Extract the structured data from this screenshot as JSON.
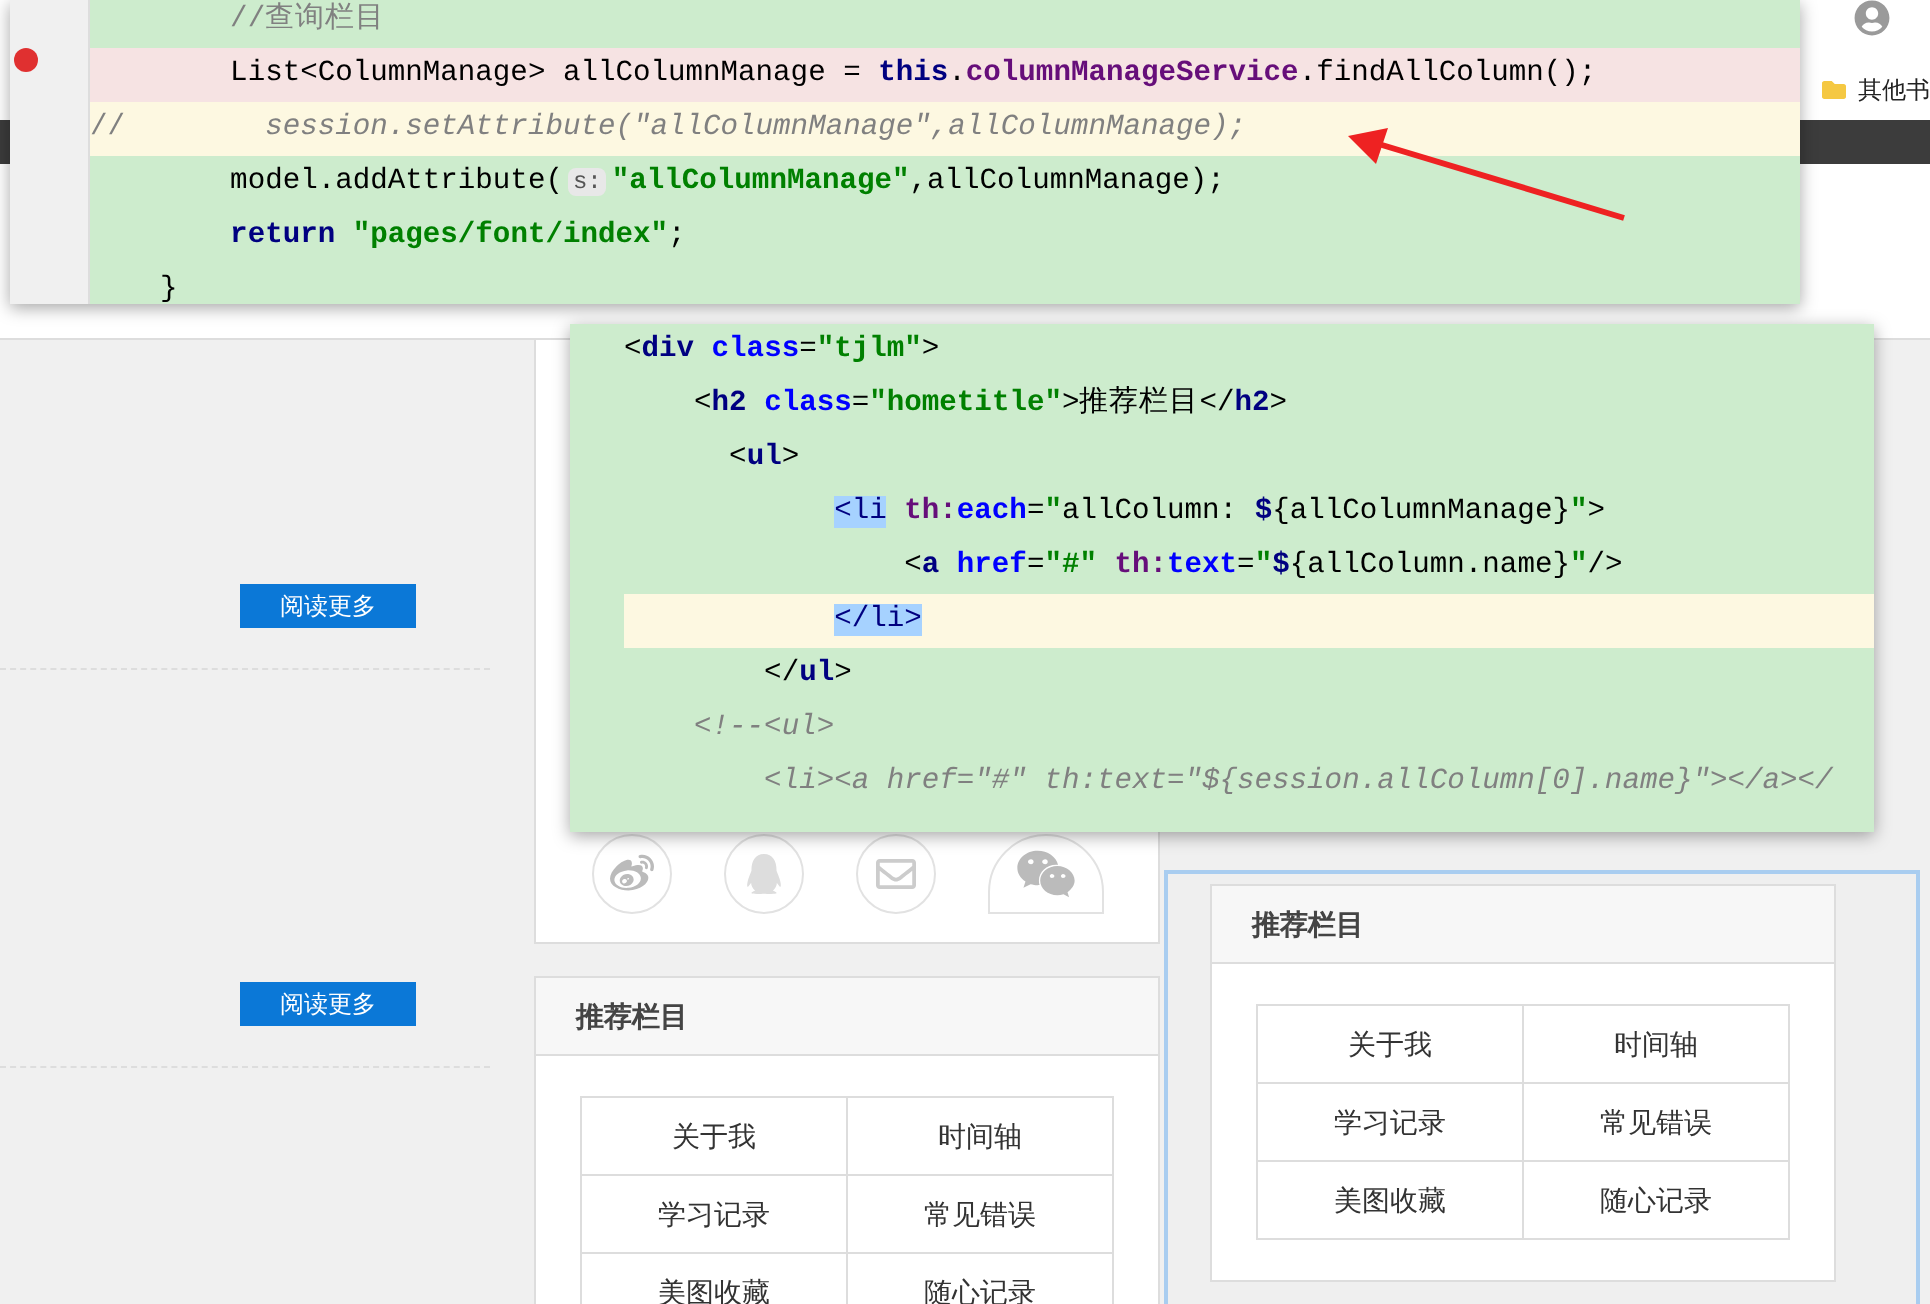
{
  "browser": {
    "bookmark": "其他书"
  },
  "page": {
    "read_more_buttons": [
      "阅读更多",
      "阅读更多"
    ],
    "recommend_card": {
      "title": "推荐栏目",
      "links": [
        "关于我",
        "时间轴",
        "学习记录",
        "常见错误",
        "美图收藏",
        "随心记录"
      ]
    }
  },
  "popup": {
    "title": "推荐栏目",
    "links": [
      "关于我",
      "时间轴",
      "学习记录",
      "常见错误",
      "美图收藏",
      "随心记录"
    ]
  },
  "editor_top": {
    "lines": [
      {
        "kind": "added",
        "segments": [
          {
            "kind": "comment",
            "text": "        //查询栏目"
          }
        ]
      },
      {
        "kind": "deleted",
        "segments": [
          {
            "kind": "plain",
            "text": "        List<ColumnManage> allColumnManage = "
          },
          {
            "kind": "keyword",
            "text": "this"
          },
          {
            "kind": "plain",
            "text": "."
          },
          {
            "kind": "field",
            "text": "columnManageService"
          },
          {
            "kind": "plain",
            "text": ".findAllColumn();"
          }
        ]
      },
      {
        "kind": "commented",
        "segments": [
          {
            "kind": "comment",
            "text": "//"
          },
          {
            "kind": "comment_italic",
            "text": "        session.setAttribute(\"allColumnManage\",allColumnManage);"
          }
        ]
      },
      {
        "kind": "added",
        "segments": [
          {
            "kind": "plain",
            "text": "        model.addAttribute("
          },
          {
            "kind": "hint",
            "text": "s:"
          },
          {
            "kind": "string",
            "text": "\"allColumnManage\""
          },
          {
            "kind": "plain",
            "text": ",allColumnManage);"
          }
        ]
      },
      {
        "kind": "added",
        "segments": [
          {
            "kind": "keyword",
            "text": "        return "
          },
          {
            "kind": "string",
            "text": "\"pages/font/index\""
          },
          {
            "kind": "plain",
            "text": ";"
          }
        ]
      },
      {
        "kind": "added",
        "segments": [
          {
            "kind": "plain",
            "text": "    }"
          }
        ]
      }
    ]
  },
  "editor_middle": {
    "lines": [
      {
        "kind": "added",
        "segments": [
          {
            "kind": "plain",
            "text": "<"
          },
          {
            "kind": "tag",
            "text": "div "
          },
          {
            "kind": "attr",
            "text": "class"
          },
          {
            "kind": "plain",
            "text": "="
          },
          {
            "kind": "string",
            "text": "\"tjlm\""
          },
          {
            "kind": "plain",
            "text": ">"
          }
        ]
      },
      {
        "kind": "added",
        "segments": [
          {
            "kind": "plain",
            "text": "    <"
          },
          {
            "kind": "tag",
            "text": "h2 "
          },
          {
            "kind": "attr",
            "text": "class"
          },
          {
            "kind": "plain",
            "text": "="
          },
          {
            "kind": "string",
            "text": "\"hometitle\""
          },
          {
            "kind": "plain",
            "text": ">推荐栏目</"
          },
          {
            "kind": "tag",
            "text": "h2"
          },
          {
            "kind": "plain",
            "text": ">"
          }
        ]
      },
      {
        "kind": "added",
        "segments": [
          {
            "kind": "plain",
            "text": "      <"
          },
          {
            "kind": "tag",
            "text": "ul"
          },
          {
            "kind": "plain",
            "text": ">"
          }
        ]
      },
      {
        "kind": "added",
        "segments": [
          {
            "kind": "match",
            "text": "            <li"
          },
          {
            "kind": "ns",
            "text": " th:"
          },
          {
            "kind": "attr",
            "text": "each"
          },
          {
            "kind": "plain",
            "text": "="
          },
          {
            "kind": "string",
            "text": "\""
          },
          {
            "kind": "plain",
            "text": "allColumn: "
          },
          {
            "kind": "tag",
            "text": "$"
          },
          {
            "kind": "plain",
            "text": "{allColumnManage}"
          },
          {
            "kind": "string",
            "text": "\""
          },
          {
            "kind": "plain",
            "text": ">"
          }
        ]
      },
      {
        "kind": "added",
        "segments": [
          {
            "kind": "plain",
            "text": "                <"
          },
          {
            "kind": "tag",
            "text": "a "
          },
          {
            "kind": "attr",
            "text": "href"
          },
          {
            "kind": "plain",
            "text": "="
          },
          {
            "kind": "string",
            "text": "\"#\" "
          },
          {
            "kind": "ns",
            "text": "th:"
          },
          {
            "kind": "attr",
            "text": "text"
          },
          {
            "kind": "plain",
            "text": "="
          },
          {
            "kind": "string",
            "text": "\""
          },
          {
            "kind": "tag",
            "text": "$"
          },
          {
            "kind": "plain",
            "text": "{allColumn.name}"
          },
          {
            "kind": "string",
            "text": "\""
          },
          {
            "kind": "plain",
            "text": "/>"
          }
        ]
      },
      {
        "kind": "current",
        "segments": [
          {
            "kind": "match",
            "text": "            </li>"
          }
        ]
      },
      {
        "kind": "added",
        "segments": [
          {
            "kind": "plain",
            "text": "        </"
          },
          {
            "kind": "tag",
            "text": "ul"
          },
          {
            "kind": "plain",
            "text": ">"
          }
        ]
      },
      {
        "kind": "added",
        "segments": [
          {
            "kind": "comment_italic",
            "text": "    <!--<ul>"
          }
        ]
      },
      {
        "kind": "added",
        "segments": [
          {
            "kind": "comment_italic",
            "text": "        <li><a href=\"#\" th:text=\"${session.allColumn[0].name}\"></a></"
          }
        ]
      }
    ]
  }
}
